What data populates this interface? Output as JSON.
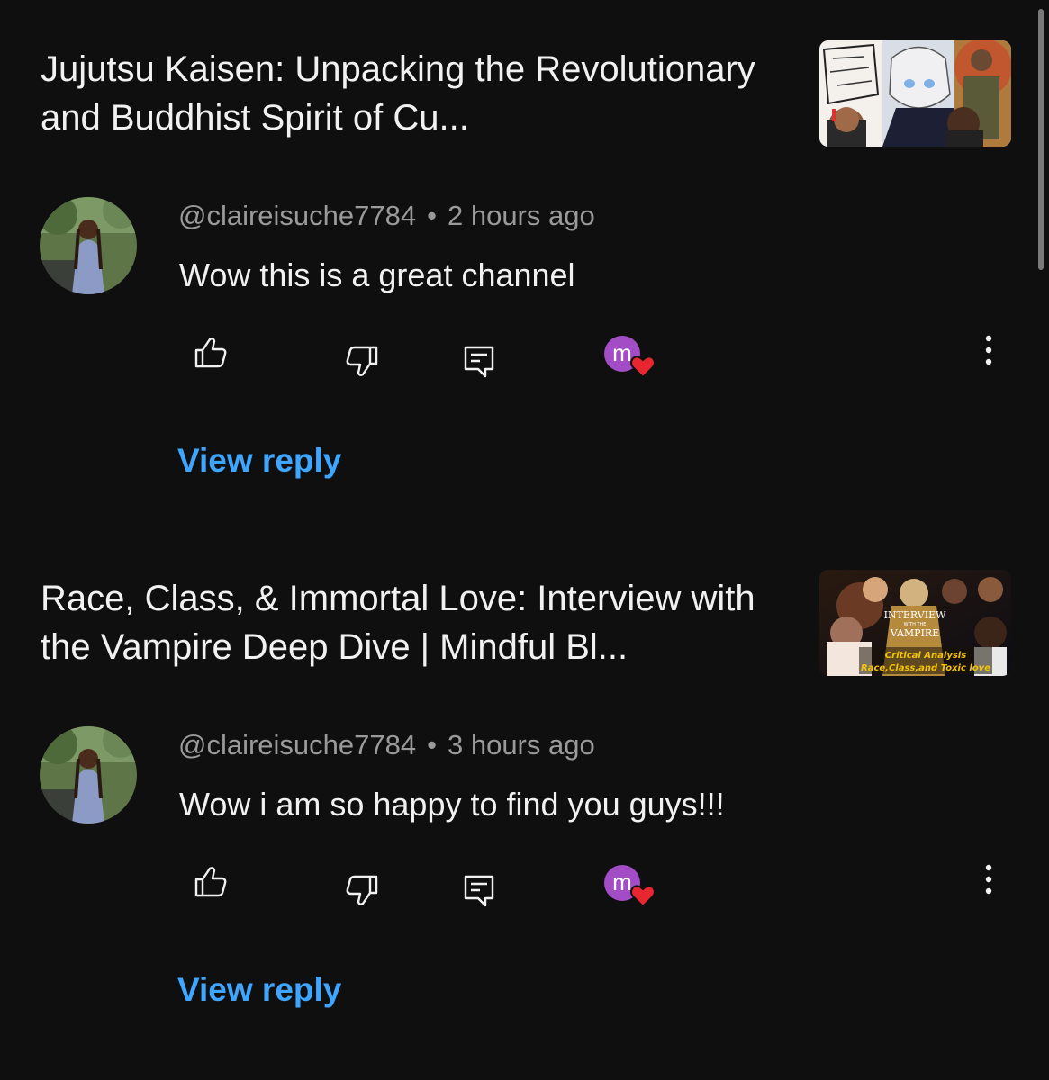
{
  "comments": [
    {
      "video_title": "Jujutsu Kaisen: Unpacking the Revolutionary and Buddhist Spirit of Cu...",
      "username": "@claireisuche7784",
      "time": "2 hours ago",
      "text": "Wow this is a great channel",
      "heart_initial": "m",
      "view_reply_label": "View reply"
    },
    {
      "video_title": "Race, Class, & Immortal Love: Interview with the Vampire Deep Dive | Mindful Bl...",
      "thumbnail_text": {
        "line1": "INTERVIEW",
        "line2": "WITH THE",
        "line3": "VAMPIRE",
        "caption1": "Critical Analysis",
        "caption2": "Race,Class,and Toxic love"
      },
      "username": "@claireisuche7784",
      "time": "3 hours ago",
      "text": "Wow i am so happy to find you guys!!!",
      "heart_initial": "m",
      "view_reply_label": "View reply"
    }
  ],
  "separator": "•",
  "colors": {
    "background": "#0f0f10",
    "link": "#3ea6ff",
    "meta": "#9a9a9a",
    "heart": "#e8262f",
    "creator_avatar": "#a24cc6"
  },
  "icons": [
    "thumbs-up-icon",
    "thumbs-down-icon",
    "reply-icon",
    "heart-icon",
    "more-vert-icon"
  ]
}
